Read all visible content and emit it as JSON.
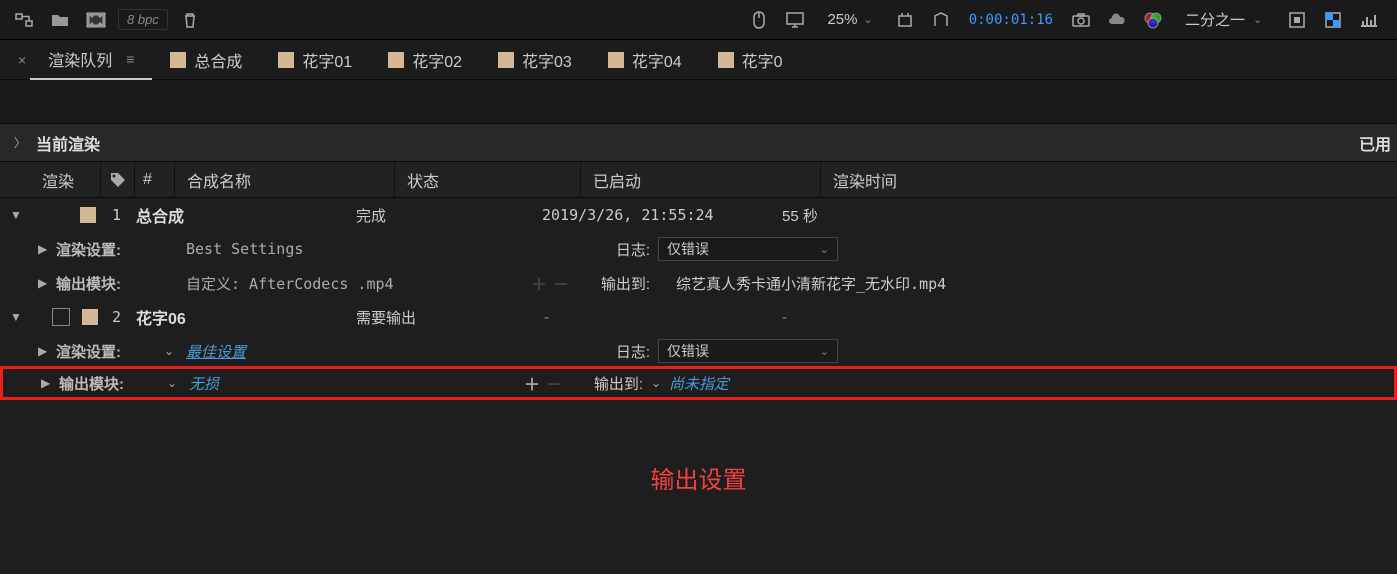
{
  "toolbar": {
    "bpc": "8 bpc",
    "zoom": "25%",
    "timecode": "0:00:01:16",
    "resolution": "二分之一"
  },
  "tabs": {
    "active": "渲染队列",
    "items": [
      "总合成",
      "花字01",
      "花字02",
      "花字03",
      "花字04",
      "花字0"
    ]
  },
  "current_render": {
    "label": "当前渲染",
    "right": "已用"
  },
  "columns": {
    "render": "渲染",
    "num": "#",
    "comp": "合成名称",
    "status": "状态",
    "started": "已启动",
    "rendertime": "渲染时间"
  },
  "queue": [
    {
      "num": "1",
      "comp": "总合成",
      "status": "完成",
      "started": "2019/3/26, 21:55:24",
      "rendertime": "55 秒",
      "render_settings_label": "渲染设置:",
      "render_settings_value": "Best Settings",
      "output_module_label": "输出模块:",
      "output_module_value": "自定义: AfterCodecs .mp4",
      "log_label": "日志:",
      "log_value": "仅错误",
      "output_to_label": "输出到:",
      "output_to_value": "综艺真人秀卡通小清新花字_无水印.mp4"
    },
    {
      "num": "2",
      "comp": "花字06",
      "status": "需要输出",
      "started": "-",
      "rendertime": "-",
      "render_settings_label": "渲染设置:",
      "render_settings_value": "最佳设置",
      "output_module_label": "输出模块:",
      "output_module_value": "无损",
      "log_label": "日志:",
      "log_value": "仅错误",
      "output_to_label": "输出到:",
      "output_to_value": "尚未指定"
    }
  ],
  "annotation": "输出设置"
}
